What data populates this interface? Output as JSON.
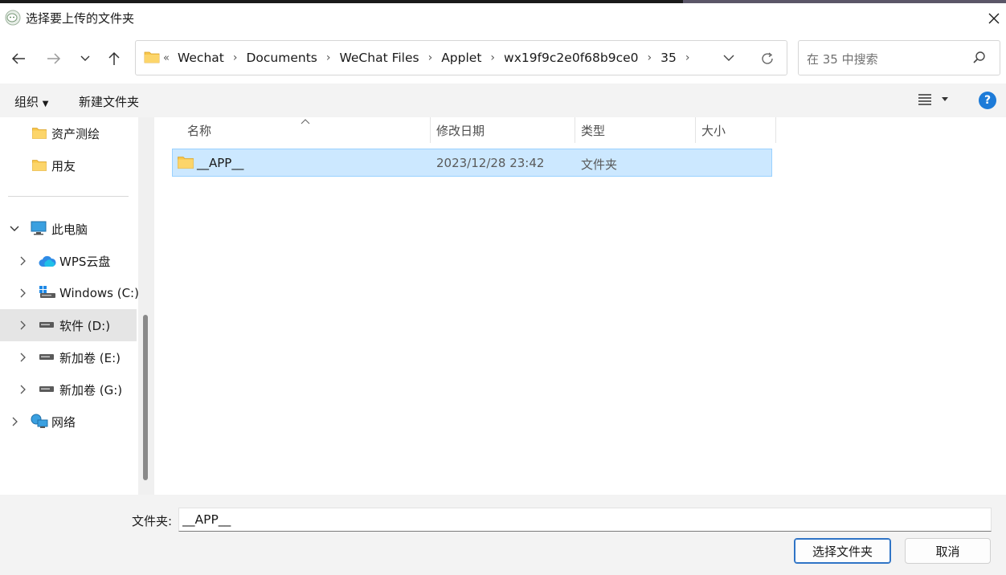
{
  "window": {
    "title": "选择要上传的文件夹",
    "app_icon": "wechat-icon"
  },
  "address_bar": {
    "overflow": "«",
    "crumbs": [
      "Wechat",
      "Documents",
      "WeChat Files",
      "Applet",
      "wx19f9c2e0f68b9ce0",
      "35"
    ]
  },
  "search": {
    "placeholder": "在 35 中搜索"
  },
  "command_bar": {
    "organize": "组织",
    "new_folder": "新建文件夹",
    "help": "?"
  },
  "sidebar": {
    "items": [
      {
        "label": "资产测绘",
        "icon": "folder-icon"
      },
      {
        "label": "用友",
        "icon": "folder-icon"
      },
      {
        "label": "此电脑",
        "icon": "computer-icon"
      },
      {
        "label": "WPS云盘",
        "icon": "cloud-icon"
      },
      {
        "label": "Windows (C:)",
        "icon": "system-drive-icon"
      },
      {
        "label": "软件 (D:)",
        "icon": "drive-icon"
      },
      {
        "label": "新加卷 (E:)",
        "icon": "drive-icon"
      },
      {
        "label": "新加卷 (G:)",
        "icon": "drive-icon"
      },
      {
        "label": "网络",
        "icon": "network-icon"
      }
    ]
  },
  "columns": {
    "name": "名称",
    "modified": "修改日期",
    "type": "类型",
    "size": "大小"
  },
  "files": [
    {
      "name": "__APP__",
      "modified": "2023/12/28 23:42",
      "type": "文件夹",
      "size": ""
    }
  ],
  "footer": {
    "folder_label": "文件夹:",
    "folder_value": "__APP__",
    "select_button": "选择文件夹",
    "cancel_button": "取消"
  },
  "colors": {
    "selection": "#cce8ff",
    "accent": "#1d7bd8",
    "folder": "#f8c64a"
  }
}
